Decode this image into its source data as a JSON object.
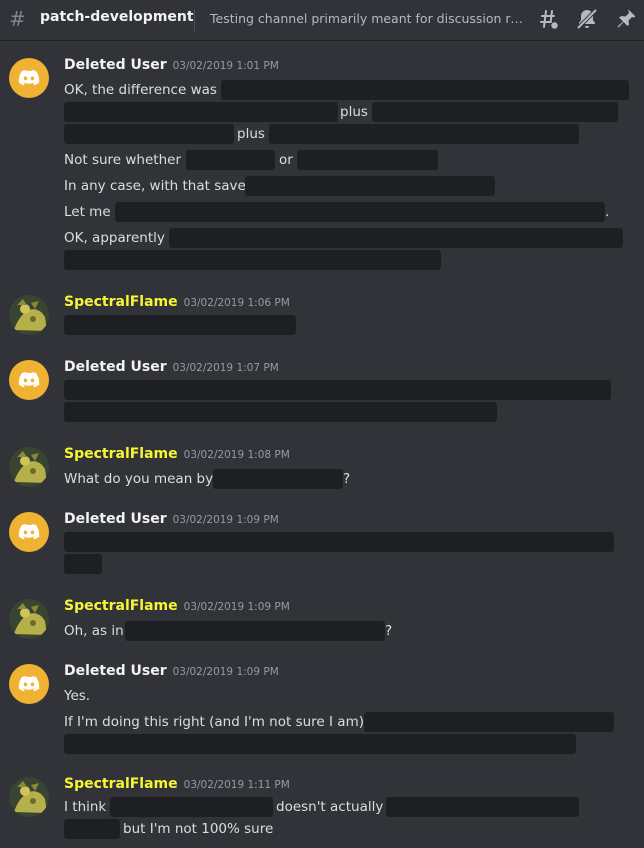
{
  "channel": {
    "name": "patch-development",
    "topic": "Testing channel primarily meant for discussion rela..."
  },
  "header_icons": [
    "threads-icon",
    "mute-bell-icon",
    "pin-icon"
  ],
  "messages": [
    {
      "author": "Deleted User",
      "timestamp": "03/02/2019 1:01 PM",
      "lines": [
        {
          "text": "OK, the difference was"
        },
        {
          "text": "plus"
        },
        {
          "text": "plus"
        },
        {
          "text": "Not sure whether",
          "text2": "or"
        },
        {
          "text": "In any case, with that save"
        },
        {
          "text": "Let me",
          "text2": "."
        },
        {
          "text": "OK, apparently"
        }
      ]
    },
    {
      "author": "SpectralFlame",
      "timestamp": "03/02/2019 1:06 PM"
    },
    {
      "author": "Deleted User",
      "timestamp": "03/02/2019 1:07 PM"
    },
    {
      "author": "SpectralFlame",
      "timestamp": "03/02/2019 1:08 PM",
      "lines": [
        {
          "text": "What do you mean by",
          "text2": "?"
        }
      ]
    },
    {
      "author": "Deleted User",
      "timestamp": "03/02/2019 1:09 PM"
    },
    {
      "author": "SpectralFlame",
      "timestamp": "03/02/2019 1:09 PM",
      "lines": [
        {
          "text": "Oh, as in",
          "text2": "?"
        }
      ]
    },
    {
      "author": "Deleted User",
      "timestamp": "03/02/2019 1:09 PM",
      "lines": [
        {
          "text": "Yes."
        },
        {
          "text": "If I'm doing this right (and I'm not sure I am),"
        }
      ]
    },
    {
      "author": "SpectralFlame",
      "timestamp": "03/02/2019 1:11 PM",
      "lines": [
        {
          "text": "I think",
          "text2": "doesn't actually"
        },
        {
          "text": "but I'm not 100% sure"
        }
      ]
    }
  ],
  "colors": {
    "background": "#313338",
    "spoiler": "#1e1f22",
    "deleted_author": "#f2f3f5",
    "spectral_author": "#f6f633",
    "discord_avatar": "#f0b232"
  }
}
